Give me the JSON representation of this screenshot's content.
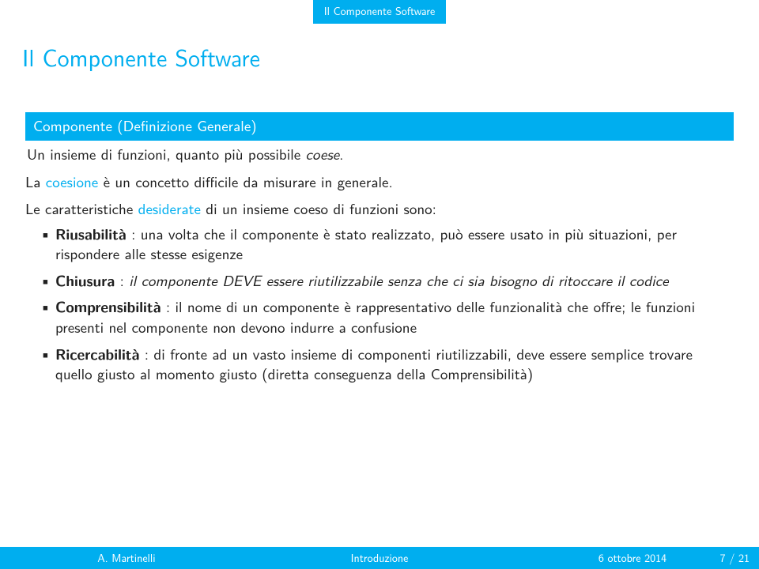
{
  "topbar": {
    "section": "Il Componente Software"
  },
  "title": "Il Componente Software",
  "block": {
    "heading": "Componente (Definizione Generale)",
    "line1_prefix": "Un insieme di funzioni, quanto più possibile ",
    "line1_emph": "coese",
    "line1_suffix": "."
  },
  "body": {
    "p1_before": "La ",
    "p1_term": "coesione",
    "p1_after": " è un concetto difficile da misurare in generale.",
    "p2_before": "Le caratteristiche ",
    "p2_term": "desiderate",
    "p2_after": " di un insieme coeso di funzioni sono:"
  },
  "bullets": [
    {
      "term": "Riusabilità",
      "text": " : una volta che il componente è stato realizzato, può essere usato in più situazioni, per rispondere alle stesse esigenze"
    },
    {
      "term": "Chiusura",
      "before": " : ",
      "emph": "il componente DEVE essere riutilizzabile senza che ci sia bisogno di ritoccare il codice",
      "after": ""
    },
    {
      "term": "Comprensibilità",
      "text": " : il nome di un componente è rappresentativo delle funzionalità che offre; le funzioni presenti nel componente non devono indurre a confusione"
    },
    {
      "term": "Ricercabilità",
      "text": " : di fronte ad un vasto insieme di componenti riutilizzabili, deve essere semplice trovare quello giusto al momento giusto (diretta conseguenza della Comprensibilità)"
    }
  ],
  "footer": {
    "author": "A. Martinelli",
    "title": "Introduzione",
    "date": "6 ottobre 2014",
    "page": "7 / 21"
  }
}
